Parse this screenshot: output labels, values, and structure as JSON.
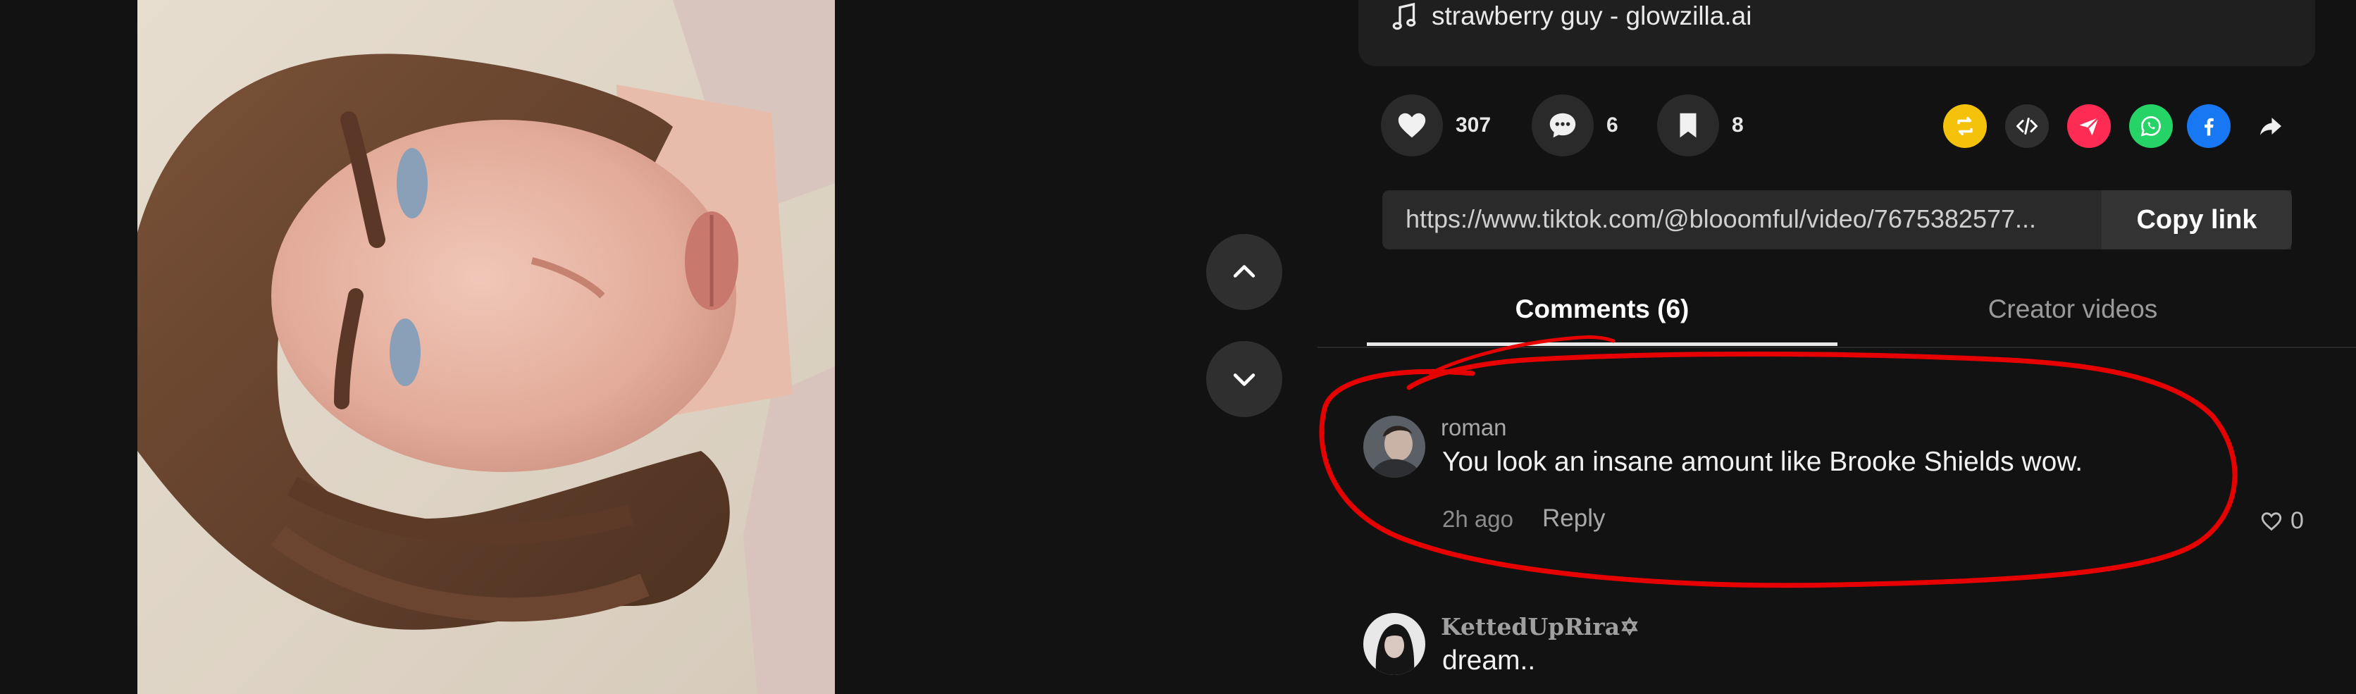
{
  "music": {
    "icon": "music-note-icon",
    "text": "strawberry guy - glowzilla.ai"
  },
  "actions": {
    "likes": {
      "icon": "heart-icon",
      "count": "307"
    },
    "comments": {
      "icon": "comment-bubble-icon",
      "count": "6"
    },
    "saves": {
      "icon": "bookmark-icon",
      "count": "8"
    }
  },
  "share": [
    {
      "name": "repost-icon",
      "color": "#F5C20B"
    },
    {
      "name": "embed-code-icon",
      "color": "#2F2F2F"
    },
    {
      "name": "send-icon",
      "color": "#FE2C55"
    },
    {
      "name": "whatsapp-icon",
      "color": "#25D366"
    },
    {
      "name": "facebook-icon",
      "color": "#1877F2"
    },
    {
      "name": "share-arrow-icon",
      "color": "#121212"
    }
  ],
  "link": {
    "url": "https://www.tiktok.com/@blooomful/video/7675382577...",
    "copy_label": "Copy link"
  },
  "tabs": {
    "comments_label": "Comments (6)",
    "creator_label": "Creator videos"
  },
  "comments": [
    {
      "username": "roman",
      "text": "You look an insane amount like Brooke Shields wow.",
      "time": "2h ago",
      "reply_label": "Reply",
      "likes": "0"
    },
    {
      "username": "KettedUpRira✡",
      "text": "dream.."
    }
  ],
  "colors": {
    "background": "#121212",
    "annotation": "#E60000"
  }
}
